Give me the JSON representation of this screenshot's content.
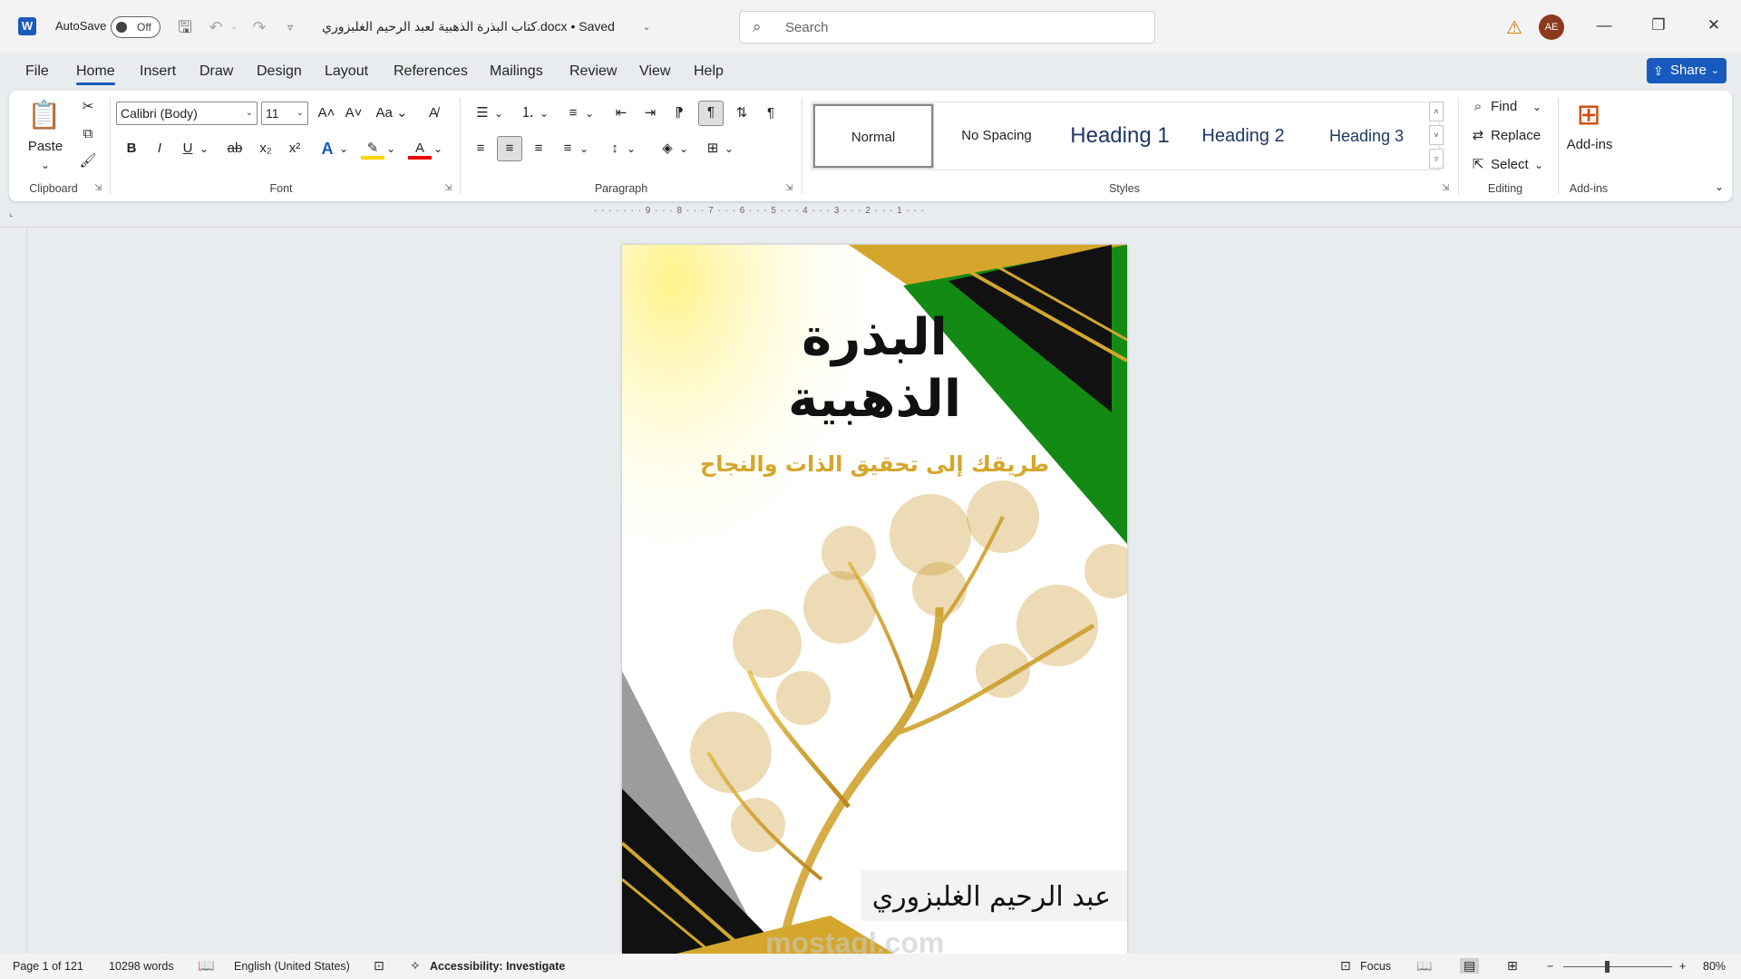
{
  "window": {
    "app_icon": "W",
    "autosave_label": "AutoSave",
    "autosave_state": "Off",
    "doc_title": "كتاب البذرة الذهبية لعبد الرحيم الغلبزوري.docx • Saved",
    "search_placeholder": "Search",
    "avatar_initials": "AE"
  },
  "tabs": [
    "File",
    "Home",
    "Insert",
    "Draw",
    "Design",
    "Layout",
    "References",
    "Mailings",
    "Review",
    "View",
    "Help"
  ],
  "active_tab": "Home",
  "share_label": "Share",
  "ribbon": {
    "clipboard": {
      "paste": "Paste",
      "label": "Clipboard"
    },
    "font": {
      "name": "Calibri (Body)",
      "size": "11",
      "label": "Font",
      "case_btn": "Aa"
    },
    "paragraph": {
      "label": "Paragraph"
    },
    "styles": {
      "label": "Styles",
      "items": [
        "Normal",
        "No Spacing",
        "Heading 1",
        "Heading 2",
        "Heading 3"
      ]
    },
    "editing": {
      "find": "Find",
      "replace": "Replace",
      "select": "Select",
      "label": "Editing"
    },
    "addins": {
      "button": "Add-ins",
      "label": "Add-ins"
    }
  },
  "ruler_text": "· · · · · · · 9 · · · 8 · · · 7 · · · 6 · · · 5 · · · 4 · · · 3 · · · 2 · · · 1 · · ·",
  "document": {
    "title_line1": "البذرة",
    "title_line2": "الذهبية",
    "subtitle": "طريقك إلى تحقيق الذات والنجاح",
    "author": "عبد الرحيم الغلبزوري",
    "watermark": "mostaql.com"
  },
  "status": {
    "page": "Page 1 of 121",
    "words": "10298 words",
    "language": "English (United States)",
    "accessibility": "Accessibility: Investigate",
    "focus": "Focus",
    "zoom": "80%"
  },
  "colors": {
    "accent": "#185abd",
    "gold": "#d4a72c",
    "green": "#138a13",
    "black": "#111111",
    "gray": "#8c8c8c"
  }
}
